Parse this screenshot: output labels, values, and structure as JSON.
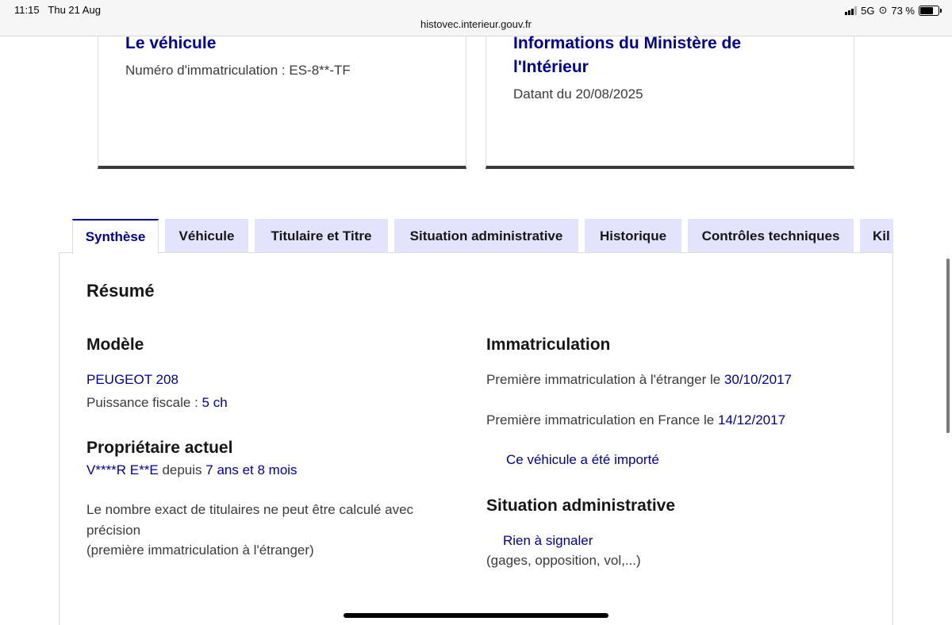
{
  "status_bar": {
    "time": "11:15",
    "date": "Thu 21 Aug",
    "network": "5G",
    "battery_text": "73 %",
    "battery_level": 0.73,
    "url": "histovec.interieur.gouv.fr"
  },
  "cards": {
    "vehicle": {
      "title": "Le véhicule",
      "plate": "Numéro d'immatriculation : ES-8**-TF"
    },
    "ministry": {
      "title_line1": "Informations du Ministère de",
      "title_line2": "l'Intérieur",
      "date": "Datant du 20/08/2025"
    }
  },
  "tabs": [
    {
      "label": "Synthèse"
    },
    {
      "label": "Véhicule"
    },
    {
      "label": "Titulaire et Titre"
    },
    {
      "label": "Situation administrative"
    },
    {
      "label": "Historique"
    },
    {
      "label": "Contrôles techniques"
    },
    {
      "label": "Kil"
    }
  ],
  "resume": {
    "title": "Résumé",
    "model": {
      "heading": "Modèle",
      "name": "PEUGEOT 208",
      "fiscal_label": "Puissance fiscale : ",
      "fiscal_value": "5 ch"
    },
    "owner": {
      "heading": "Propriétaire actuel",
      "name": "V****R E**E",
      "since_label": " depuis ",
      "duration": "7 ans et 8 mois",
      "note_line1": "Le nombre exact de titulaires ne peut être calculé avec",
      "note_line2": "précision",
      "note_line3": "(première immatriculation à l'étranger)"
    },
    "registration": {
      "heading": "Immatriculation",
      "foreign_label": "Première immatriculation à l'étranger le ",
      "foreign_date": "30/10/2017",
      "france_label": "Première immatriculation en France le ",
      "france_date": "14/12/2017",
      "imported": "Ce véhicule a été importé"
    },
    "admin": {
      "heading": "Situation administrative",
      "status": "Rien à signaler",
      "details": "(gages, opposition, vol,...)"
    }
  },
  "colors": {
    "brand_blue": "#000091",
    "tab_bg": "#e3e3fd",
    "card_border": "#3a3a3a"
  }
}
